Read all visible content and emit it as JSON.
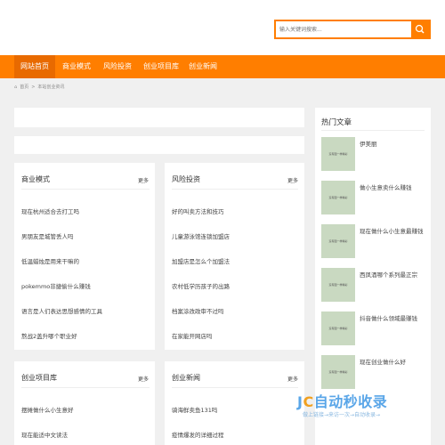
{
  "search": {
    "placeholder": "输入关键词搜索..."
  },
  "nav": [
    "网站首页",
    "商业模式",
    "风险投资",
    "创业项目库",
    "创业新闻"
  ],
  "breadcrumb": {
    "home": "首页",
    "sep": ">",
    "current": "本站创业资讯"
  },
  "cards": [
    {
      "title": "商业模式",
      "more": "更多",
      "items": [
        "现在杭州适合去打工吗",
        "男朋友是城管丢人吗",
        "低温蜡烛是用来干嘛的",
        "pokemmo非捷偷什么赚钱",
        "语言是人们表达思想感情的工具",
        "熬战2盖升哪个职业好"
      ]
    },
    {
      "title": "风险投资",
      "more": "更多",
      "items": [
        "好的叫卖方法和技巧",
        "儿童游泳馆连锁加盟店",
        "加盟店是怎么个加盟法",
        "农村低学历孩子的出路",
        "档案涂改政审不过吗",
        "在家能开网店吗"
      ]
    },
    {
      "title": "创业项目库",
      "more": "更多",
      "items": [
        "摆摊做什么小生意好",
        "现在能适中文读法"
      ]
    },
    {
      "title": "创业新闻",
      "more": "更多",
      "items": [
        "骑海鲜卖鱼131吗",
        "疫情爆发的详细过程"
      ]
    }
  ],
  "hot": {
    "title": "热门文章",
    "thumb_text": "没有图一样精彩",
    "items": [
      "伊美丽",
      "做小生意卖什么赚钱",
      "现在做什么小生意最赚钱",
      "西凤酒哪个系列最正宗",
      "抖音做什么领域最赚钱",
      "现在创业做什么好"
    ]
  },
  "watermark": {
    "logo_a": "J",
    "logo_b": "C",
    "logo_rest": "自动秒收录",
    "sub": "做上链接→来访一次→自动收录→"
  }
}
